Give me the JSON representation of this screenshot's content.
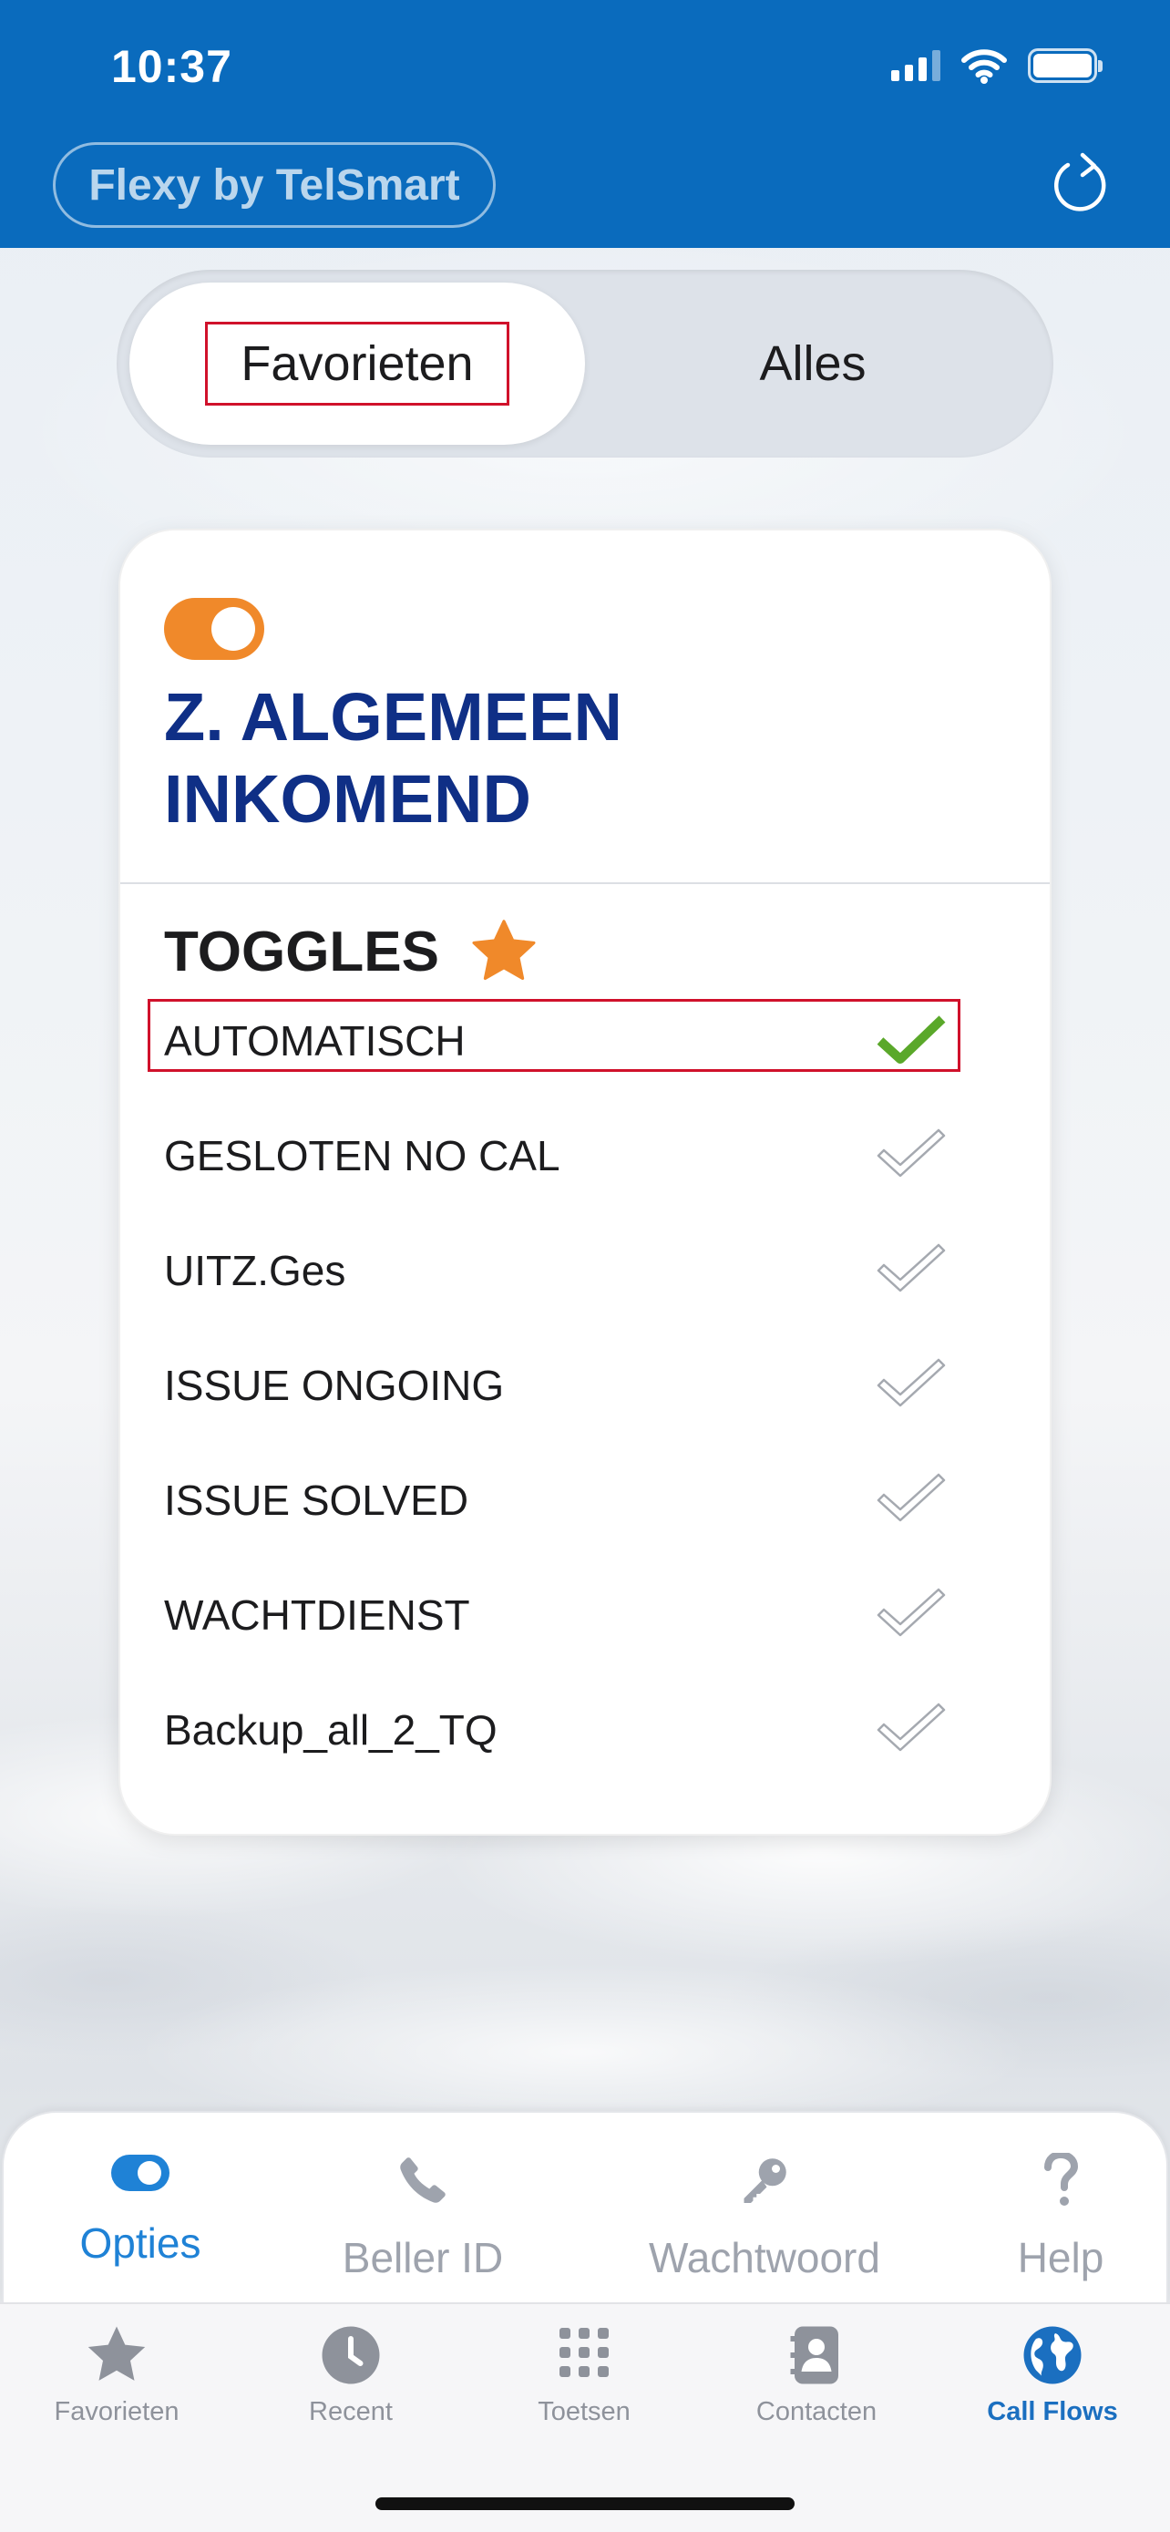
{
  "status_bar": {
    "time": "10:37"
  },
  "header": {
    "brand": "Flexy by TelSmart",
    "refresh_icon": "refresh-icon"
  },
  "segment": {
    "active": "Favorieten",
    "inactive": "Alles"
  },
  "card": {
    "enabled": true,
    "title_line1": "Z. ALGEMEEN",
    "title_line2": "INKOMEND",
    "section_title": "TOGGLES",
    "section_icon": "star-icon",
    "toggles": [
      {
        "label": "AUTOMATISCH",
        "checked": true
      },
      {
        "label": "GESLOTEN NO CAL",
        "checked": false
      },
      {
        "label": "UITZ.Ges",
        "checked": false
      },
      {
        "label": "ISSUE ONGOING",
        "checked": false
      },
      {
        "label": "ISSUE SOLVED",
        "checked": false
      },
      {
        "label": "WACHTDIENST",
        "checked": false
      },
      {
        "label": "Backup_all_2_TQ",
        "checked": false
      }
    ]
  },
  "options": [
    {
      "label": "Opties",
      "icon": "toggle-icon",
      "active": true
    },
    {
      "label": "Beller ID",
      "icon": "phone-icon",
      "active": false
    },
    {
      "label": "Wachtwoord",
      "icon": "key-icon",
      "active": false
    },
    {
      "label": "Help",
      "icon": "question-icon",
      "active": false
    }
  ],
  "tabs": [
    {
      "label": "Favorieten",
      "icon": "star-icon",
      "active": false
    },
    {
      "label": "Recent",
      "icon": "clock-icon",
      "active": false
    },
    {
      "label": "Toetsen",
      "icon": "keypad-icon",
      "active": false
    },
    {
      "label": "Contacten",
      "icon": "contacts-icon",
      "active": false
    },
    {
      "label": "Call Flows",
      "icon": "globe-icon",
      "active": true
    }
  ],
  "colors": {
    "header": "#0a6bbd",
    "title": "#0f2f86",
    "accent_orange": "#f0892a",
    "active_blue": "#1f82d6",
    "check_green": "#5aa82a"
  }
}
